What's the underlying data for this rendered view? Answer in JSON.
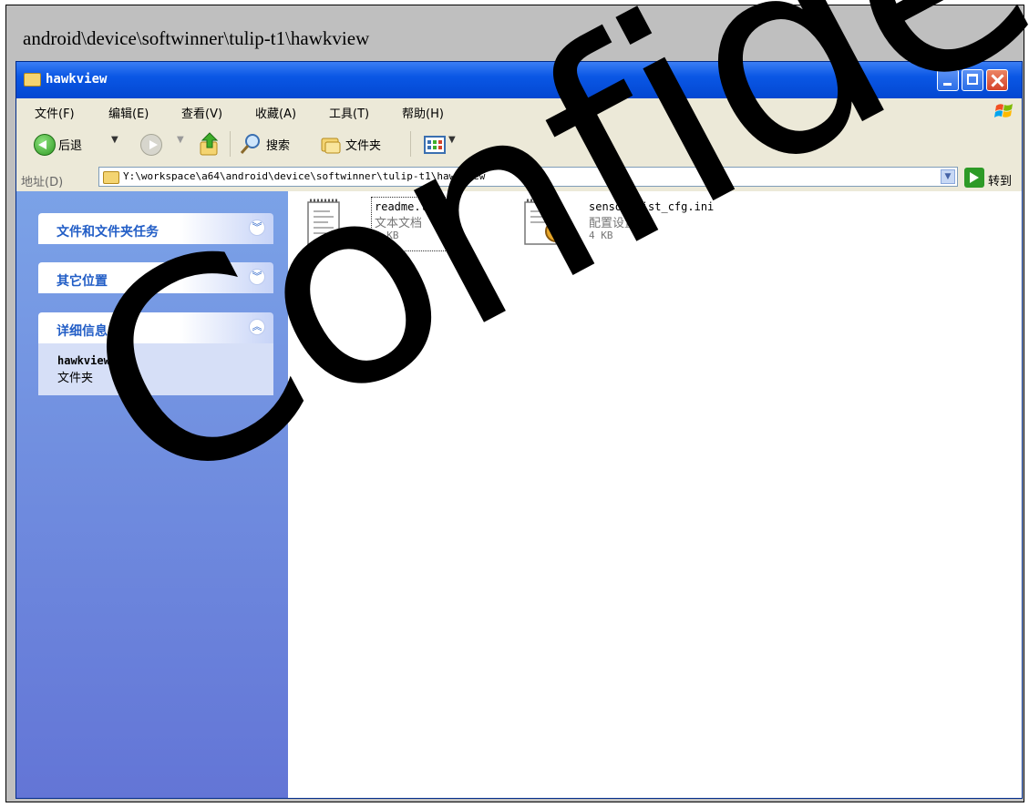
{
  "caption": "android\\device\\softwinner\\tulip-t1\\hawkview",
  "window": {
    "title": "hawkview"
  },
  "menu": [
    "文件(F)",
    "编辑(E)",
    "查看(V)",
    "收藏(A)",
    "工具(T)",
    "帮助(H)"
  ],
  "toolbar": {
    "back_label": "后退",
    "search_label": "搜索",
    "folders_label": "文件夹"
  },
  "address": {
    "label": "地址(D)",
    "path": "Y:\\workspace\\a64\\android\\device\\softwinner\\tulip-t1\\hawkview",
    "go_label": "转到"
  },
  "sidebar": {
    "panels": [
      {
        "title": "文件和文件夹任务",
        "state": "collapsed"
      },
      {
        "title": "其它位置",
        "state": "collapsed"
      },
      {
        "title": "详细信息",
        "state": "expanded"
      }
    ],
    "details": {
      "name": "hawkview",
      "type": "文件夹"
    }
  },
  "files": [
    {
      "name": "readme.txt",
      "type": "文本文档",
      "size": "2 KB",
      "icon": "text-document-icon"
    },
    {
      "name": "sensor_list_cfg.ini",
      "type": "配置设置",
      "size": "4 KB",
      "icon": "config-settings-icon"
    }
  ],
  "watermark": "Confidential",
  "colors": {
    "titlebar": "#0a57e5",
    "sidebar": "#7ba2e7",
    "panel_title": "#215dc6"
  }
}
